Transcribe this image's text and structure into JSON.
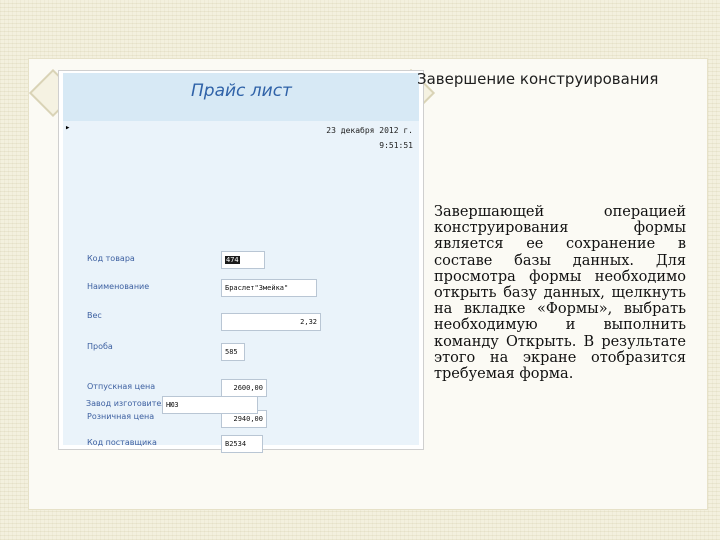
{
  "slide": {
    "title": "Завершение конструирования",
    "body": "Завершающей операцией конструирования формы является ее сохранение в составе базы данных. Для просмотра формы необходимо открыть базу данных, щелкнуть на вкладке «Формы», выбрать необходимую и выполнить команду Открыть. В результате этого на экране отобразится требуемая форма."
  },
  "form": {
    "title": "Прайс лист",
    "record_selector": "▸",
    "date": "23 декабря 2012 г.",
    "time": "9:51:51",
    "fields": [
      {
        "label": "Код товара",
        "value": "474"
      },
      {
        "label": "Наименование",
        "value": "Браслет\"Змейка\""
      },
      {
        "label": "Вес",
        "value": "2,32"
      },
      {
        "label": "Проба",
        "value": "585"
      },
      {
        "label": "Отпускная цена",
        "value": "2600,00"
      },
      {
        "label": "Розничная цена",
        "value": "2940,00"
      },
      {
        "label": "Код поставщика",
        "value": "B2534"
      },
      {
        "label": "Завод изготовитель",
        "value": "НЮЗ"
      }
    ]
  }
}
